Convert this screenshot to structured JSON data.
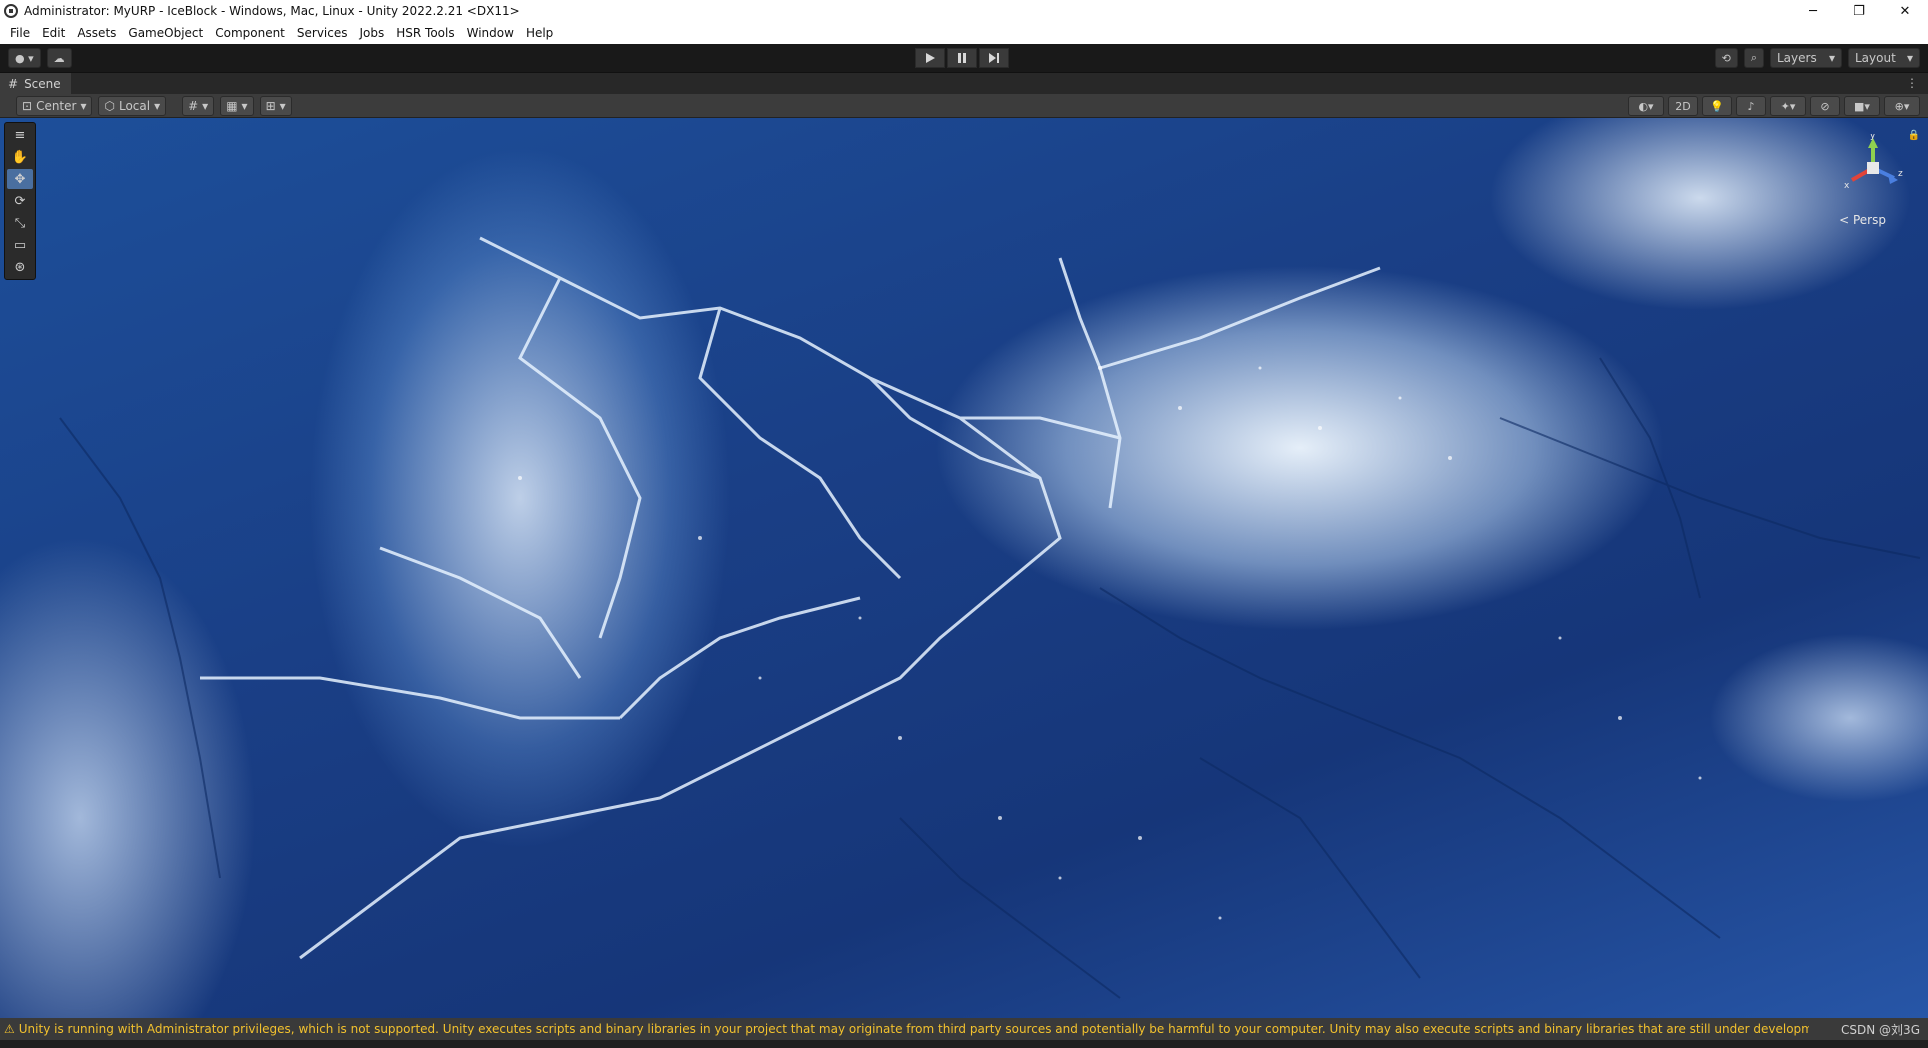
{
  "window": {
    "title": "Administrator: MyURP - IceBlock - Windows, Mac, Linux - Unity 2022.2.21 <DX11>",
    "minimize": "─",
    "restore": "❐",
    "close": "✕"
  },
  "menu": [
    "File",
    "Edit",
    "Assets",
    "GameObject",
    "Component",
    "Services",
    "Jobs",
    "HSR Tools",
    "Window",
    "Help"
  ],
  "toolbar": {
    "layers_label": "Layers",
    "layout_label": "Layout"
  },
  "tab": {
    "label": "Scene"
  },
  "scene_toolbar": {
    "pivot_label": "Center",
    "space_label": "Local",
    "mode_2d": "2D"
  },
  "viewport": {
    "projection_label": "< Persp",
    "gizmo_axes": {
      "y": "y",
      "x": "x",
      "z": "z"
    }
  },
  "status": {
    "warning": "Unity is running with Administrator privileges, which is not supported. Unity executes scripts and binary libraries in your project that may originate from third party sources and potentially be harmful to your computer. Unity may also execute scripts and binary libraries that are still under development and not yet fully teste",
    "watermark": "CSDN @刘3G"
  },
  "colors": {
    "accent": "#4a6fa0",
    "warning": "#f2c12e",
    "ice_deep": "#163679",
    "ice_light": "#e8f3ff"
  }
}
